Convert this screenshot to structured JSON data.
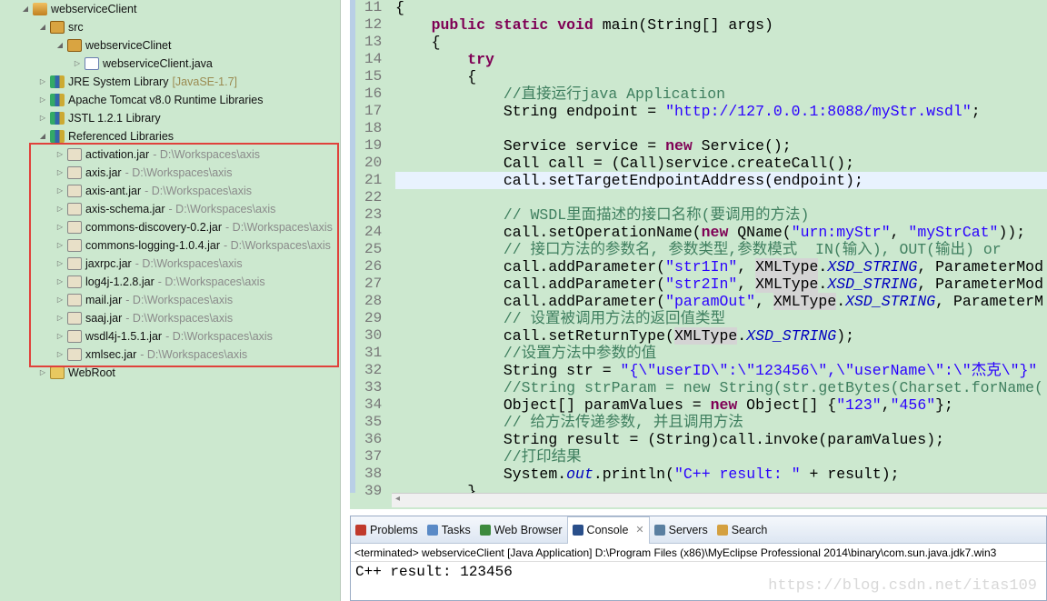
{
  "tree": {
    "items": [
      {
        "label": "webserviceClient",
        "icon": "project-icon",
        "expanded": true,
        "depth": 0
      },
      {
        "label": "src",
        "icon": "source-folder-icon",
        "expanded": true,
        "depth": 1
      },
      {
        "label": "webserviceClinet",
        "icon": "package-icon",
        "expanded": true,
        "depth": 2
      },
      {
        "label": "webserviceClient.java",
        "icon": "java-file-icon",
        "expanded": false,
        "depth": 3
      },
      {
        "label": "JRE System Library",
        "suffix": "[JavaSE-1.7]",
        "icon": "library-icon",
        "expanded": false,
        "depth": 1
      },
      {
        "label": "Apache Tomcat v8.0 Runtime Libraries",
        "icon": "library-icon",
        "expanded": false,
        "depth": 1
      },
      {
        "label": "JSTL 1.2.1 Library",
        "icon": "library-icon",
        "expanded": false,
        "depth": 1
      },
      {
        "label": "Referenced Libraries",
        "icon": "library-icon",
        "expanded": true,
        "depth": 1
      },
      {
        "label": "activation.jar",
        "path": "- D:\\Workspaces\\axis",
        "icon": "jar-icon",
        "depth": 2
      },
      {
        "label": "axis.jar",
        "path": "- D:\\Workspaces\\axis",
        "icon": "jar-icon",
        "depth": 2
      },
      {
        "label": "axis-ant.jar",
        "path": "- D:\\Workspaces\\axis",
        "icon": "jar-icon",
        "depth": 2
      },
      {
        "label": "axis-schema.jar",
        "path": "- D:\\Workspaces\\axis",
        "icon": "jar-icon",
        "depth": 2
      },
      {
        "label": "commons-discovery-0.2.jar",
        "path": "- D:\\Workspaces\\axis",
        "icon": "jar-icon",
        "depth": 2
      },
      {
        "label": "commons-logging-1.0.4.jar",
        "path": "- D:\\Workspaces\\axis",
        "icon": "jar-icon",
        "depth": 2
      },
      {
        "label": "jaxrpc.jar",
        "path": "- D:\\Workspaces\\axis",
        "icon": "jar-icon",
        "depth": 2
      },
      {
        "label": "log4j-1.2.8.jar",
        "path": "- D:\\Workspaces\\axis",
        "icon": "jar-icon",
        "depth": 2
      },
      {
        "label": "mail.jar",
        "path": "- D:\\Workspaces\\axis",
        "icon": "jar-icon",
        "depth": 2
      },
      {
        "label": "saaj.jar",
        "path": "- D:\\Workspaces\\axis",
        "icon": "jar-icon",
        "depth": 2
      },
      {
        "label": "wsdl4j-1.5.1.jar",
        "path": "- D:\\Workspaces\\axis",
        "icon": "jar-icon",
        "depth": 2
      },
      {
        "label": "xmlsec.jar",
        "path": "- D:\\Workspaces\\axis",
        "icon": "jar-icon",
        "depth": 2
      },
      {
        "label": "WebRoot",
        "icon": "folder-icon",
        "expanded": false,
        "depth": 1
      }
    ]
  },
  "editor": {
    "current_line": 21,
    "lines": [
      {
        "n": "11",
        "seg": [
          [
            "p",
            "{"
          ]
        ]
      },
      {
        "n": "12",
        "seg": [
          [
            "p",
            "    "
          ],
          [
            "kw",
            "public static void"
          ],
          [
            "p",
            " main(String[] args)"
          ]
        ]
      },
      {
        "n": "13",
        "seg": [
          [
            "p",
            "    {"
          ]
        ]
      },
      {
        "n": "14",
        "seg": [
          [
            "p",
            "        "
          ],
          [
            "kw",
            "try"
          ]
        ]
      },
      {
        "n": "15",
        "seg": [
          [
            "p",
            "        {"
          ]
        ]
      },
      {
        "n": "16",
        "seg": [
          [
            "p",
            "            "
          ],
          [
            "cmt",
            "//直接运行java Application"
          ]
        ]
      },
      {
        "n": "17",
        "seg": [
          [
            "p",
            "            String endpoint = "
          ],
          [
            "str",
            "\"http://127.0.0.1:8088/myStr.wsdl\""
          ],
          [
            "p",
            ";"
          ]
        ]
      },
      {
        "n": "18",
        "seg": [
          [
            "p",
            ""
          ]
        ]
      },
      {
        "n": "19",
        "seg": [
          [
            "p",
            "            Service service = "
          ],
          [
            "kw",
            "new"
          ],
          [
            "p",
            " Service();"
          ]
        ]
      },
      {
        "n": "20",
        "seg": [
          [
            "p",
            "            Call call = (Call)service.createCall();"
          ]
        ]
      },
      {
        "n": "21",
        "seg": [
          [
            "p",
            "            call.setTargetEndpointAddress(endpoint);"
          ]
        ]
      },
      {
        "n": "22",
        "seg": [
          [
            "p",
            ""
          ]
        ]
      },
      {
        "n": "23",
        "seg": [
          [
            "p",
            "            "
          ],
          [
            "cmt",
            "// WSDL里面描述的接口名称(要调用的方法)"
          ]
        ]
      },
      {
        "n": "24",
        "seg": [
          [
            "p",
            "            call.setOperationName("
          ],
          [
            "kw",
            "new"
          ],
          [
            "p",
            " QName("
          ],
          [
            "str",
            "\"urn:myStr\""
          ],
          [
            "p",
            ", "
          ],
          [
            "str",
            "\"myStrCat\""
          ],
          [
            "p",
            "));"
          ]
        ]
      },
      {
        "n": "25",
        "seg": [
          [
            "p",
            "            "
          ],
          [
            "cmt",
            "// 接口方法的参数名, 参数类型,参数模式  IN(输入), OUT(输出) or"
          ]
        ]
      },
      {
        "n": "26",
        "seg": [
          [
            "p",
            "            call.addParameter("
          ],
          [
            "str",
            "\"str1In\""
          ],
          [
            "p",
            ", "
          ],
          [
            "hl",
            "XMLType"
          ],
          [
            "p",
            "."
          ],
          [
            "ital",
            "XSD_STRING"
          ],
          [
            "p",
            ", ParameterMod"
          ]
        ]
      },
      {
        "n": "27",
        "seg": [
          [
            "p",
            "            call.addParameter("
          ],
          [
            "str",
            "\"str2In\""
          ],
          [
            "p",
            ", "
          ],
          [
            "hl",
            "XMLType"
          ],
          [
            "p",
            "."
          ],
          [
            "ital",
            "XSD_STRING"
          ],
          [
            "p",
            ", ParameterMod"
          ]
        ]
      },
      {
        "n": "28",
        "seg": [
          [
            "p",
            "            call.addParameter("
          ],
          [
            "str",
            "\"paramOut\""
          ],
          [
            "p",
            ", "
          ],
          [
            "hl",
            "XMLType"
          ],
          [
            "p",
            "."
          ],
          [
            "ital",
            "XSD_STRING"
          ],
          [
            "p",
            ", ParameterM"
          ]
        ]
      },
      {
        "n": "29",
        "seg": [
          [
            "p",
            "            "
          ],
          [
            "cmt",
            "// 设置被调用方法的返回值类型"
          ]
        ]
      },
      {
        "n": "30",
        "seg": [
          [
            "p",
            "            call.setReturnType("
          ],
          [
            "hl",
            "XMLType"
          ],
          [
            "p",
            "."
          ],
          [
            "ital",
            "XSD_STRING"
          ],
          [
            "p",
            ");"
          ]
        ]
      },
      {
        "n": "31",
        "seg": [
          [
            "p",
            "            "
          ],
          [
            "cmt",
            "//设置方法中参数的值"
          ]
        ]
      },
      {
        "n": "32",
        "seg": [
          [
            "p",
            "            String str = "
          ],
          [
            "str",
            "\"{\\\"userID\\\":\\\"123456\\\",\\\"userName\\\":\\\"杰克\\\"}\""
          ]
        ]
      },
      {
        "n": "33",
        "seg": [
          [
            "p",
            "            "
          ],
          [
            "cmt",
            "//String strParam = new String(str.getBytes(Charset.forName("
          ]
        ]
      },
      {
        "n": "34",
        "seg": [
          [
            "p",
            "            Object[] paramValues = "
          ],
          [
            "kw",
            "new"
          ],
          [
            "p",
            " Object[] {"
          ],
          [
            "str",
            "\"123\""
          ],
          [
            "p",
            ","
          ],
          [
            "str",
            "\"456\""
          ],
          [
            "p",
            "};"
          ]
        ]
      },
      {
        "n": "35",
        "seg": [
          [
            "p",
            "            "
          ],
          [
            "cmt",
            "// 给方法传递参数, 并且调用方法"
          ]
        ]
      },
      {
        "n": "36",
        "seg": [
          [
            "p",
            "            String result = (String)call.invoke(paramValues);"
          ]
        ]
      },
      {
        "n": "37",
        "seg": [
          [
            "p",
            "            "
          ],
          [
            "cmt",
            "//打印结果"
          ]
        ]
      },
      {
        "n": "38",
        "seg": [
          [
            "p",
            "            System."
          ],
          [
            "ital",
            "out"
          ],
          [
            "p",
            ".println("
          ],
          [
            "str",
            "\"C++ result: \""
          ],
          [
            "p",
            " + result);"
          ]
        ]
      },
      {
        "n": "39",
        "seg": [
          [
            "p",
            "        }"
          ]
        ]
      }
    ]
  },
  "bottom": {
    "tabs": [
      {
        "label": "Problems",
        "icon": "problems-icon",
        "color": "#c0392b"
      },
      {
        "label": "Tasks",
        "icon": "tasks-icon",
        "color": "#5a8ac6"
      },
      {
        "label": "Web Browser",
        "icon": "globe-icon",
        "color": "#3d8a3d"
      },
      {
        "label": "Console",
        "icon": "console-icon",
        "color": "#2a4f8a",
        "active": true,
        "closable": true
      },
      {
        "label": "Servers",
        "icon": "servers-icon",
        "color": "#5a7fa0"
      },
      {
        "label": "Search",
        "icon": "search-icon",
        "color": "#d4a040"
      }
    ],
    "status": "<terminated> webserviceClient [Java Application] D:\\Program Files (x86)\\MyEclipse Professional 2014\\binary\\com.sun.java.jdk7.win3",
    "output": "C++ result: 123456",
    "watermark": "https://blog.csdn.net/itas109"
  },
  "colors": {
    "background": "#cce8cf",
    "highlight_box": "#e0413b",
    "keyword": "#7f0055",
    "string": "#2a00ff",
    "comment": "#3f7f5f"
  }
}
